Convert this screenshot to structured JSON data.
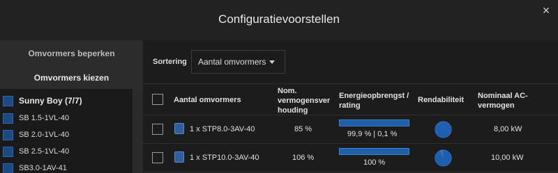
{
  "dialog": {
    "title": "Configuratievoorstellen",
    "close_icon": "×"
  },
  "sidebar": {
    "tab_limit": "Omvormers beperken",
    "tab_choose": "Omvormers kiezen",
    "group": "Sunny Boy (7/7)",
    "items": [
      "SB 1.5-1VL-40",
      "SB 2.0-1VL-40",
      "SB 2.5-1VL-40",
      "SB3.0-1AV-41"
    ]
  },
  "sort": {
    "label": "Sortering",
    "value": "Aantal omvormers"
  },
  "table": {
    "headers": {
      "count": "Aantal omvormers",
      "ratio": "Nom. vermogensverhouding",
      "ratio_lines": [
        "Nom.",
        "vermogensver",
        "houding"
      ],
      "energy_lines": [
        "Energieopbrengst /",
        "rating"
      ],
      "yield": "Rendabiliteit",
      "ac_lines": [
        "Nominaal AC-",
        "vermogen"
      ]
    },
    "rows": [
      {
        "inverter": "1 x STP8.0-3AV-40",
        "ratio": "85 %",
        "energy": "99,9 % | 0,1 %",
        "energy_fill": 0.999,
        "yield_fill": 1.0,
        "ac": "8,00 kW"
      },
      {
        "inverter": "1 x STP10.0-3AV-40",
        "ratio": "106 %",
        "energy": "100 %",
        "energy_fill": 1.0,
        "yield_fill": 0.93,
        "ac": "10,00 kW"
      }
    ]
  },
  "colors": {
    "accent": "#1f5fa8",
    "checkbox_blue": "#1b4a83"
  }
}
